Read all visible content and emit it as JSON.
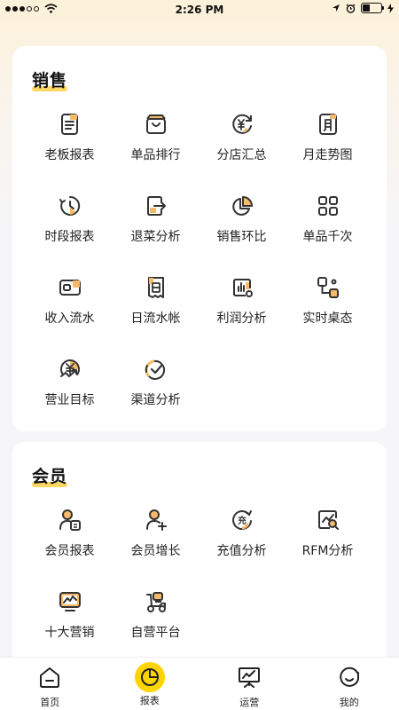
{
  "status_bar": {
    "time": "2:26 PM"
  },
  "sections": [
    {
      "title": "销售",
      "items": [
        {
          "label": "老板报表",
          "icon": "report-doc-icon"
        },
        {
          "label": "单品排行",
          "icon": "bag-icon"
        },
        {
          "label": "分店汇总",
          "icon": "yuan-cycle-icon"
        },
        {
          "label": "月走势图",
          "icon": "month-calendar-icon"
        },
        {
          "label": "时段报表",
          "icon": "clock-icon"
        },
        {
          "label": "退菜分析",
          "icon": "exit-box-icon"
        },
        {
          "label": "销售环比",
          "icon": "pie-chart-icon"
        },
        {
          "label": "单品千次",
          "icon": "grid-four-icon"
        },
        {
          "label": "收入流水",
          "icon": "wallet-icon"
        },
        {
          "label": "日流水帐",
          "icon": "daily-receipt-icon"
        },
        {
          "label": "利润分析",
          "icon": "bar-chart-icon"
        },
        {
          "label": "实时桌态",
          "icon": "flow-nodes-icon"
        },
        {
          "label": "营业目标",
          "icon": "yuan-target-icon"
        },
        {
          "label": "渠道分析",
          "icon": "channel-check-icon"
        }
      ]
    },
    {
      "title": "会员",
      "items": [
        {
          "label": "会员报表",
          "icon": "member-card-icon"
        },
        {
          "label": "会员增长",
          "icon": "member-add-icon"
        },
        {
          "label": "充值分析",
          "icon": "recharge-icon"
        },
        {
          "label": "RFM分析",
          "icon": "rfm-search-icon"
        },
        {
          "label": "十大营销",
          "icon": "monitor-trend-icon"
        },
        {
          "label": "自营平台",
          "icon": "delivery-scooter-icon"
        }
      ]
    }
  ],
  "tab_bar": [
    {
      "label": "首页",
      "icon": "home-icon",
      "active": false
    },
    {
      "label": "报表",
      "icon": "pie-chart-tab-icon",
      "active": true
    },
    {
      "label": "运营",
      "icon": "presentation-chart-icon",
      "active": false
    },
    {
      "label": "我的",
      "icon": "smile-face-icon",
      "active": false
    }
  ],
  "colors": {
    "accent": "#ffd400",
    "accent_light": "#ffd766",
    "icon_fill": "#f7b96a",
    "icon_stroke": "#333333"
  }
}
